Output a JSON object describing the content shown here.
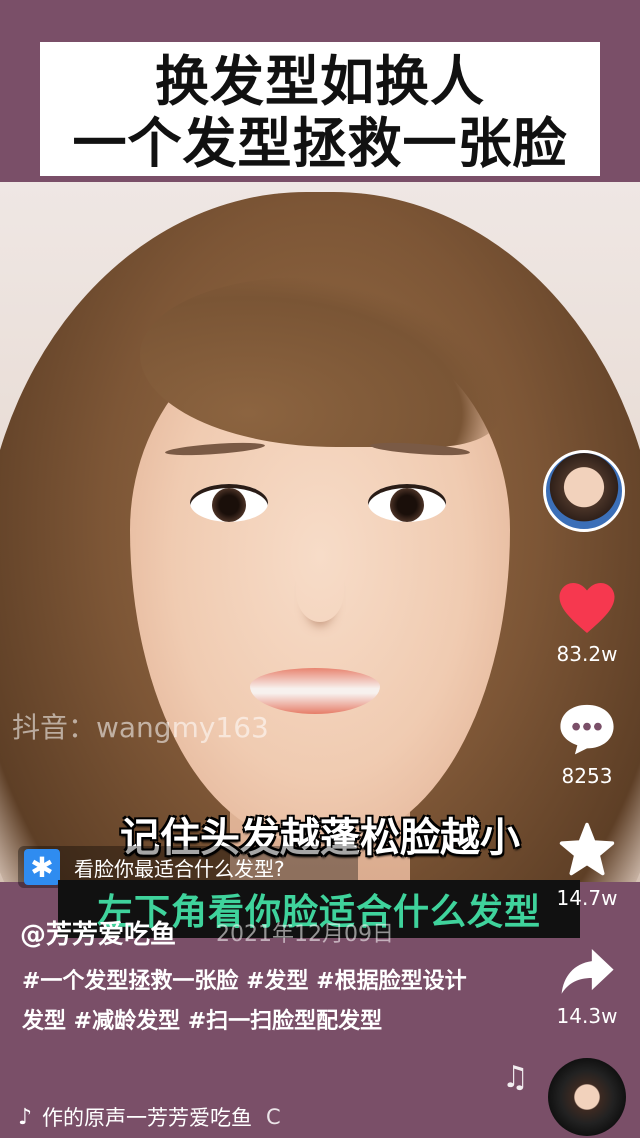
{
  "title": {
    "line1": "换发型如换人",
    "line2": "一个发型拯救一张脸"
  },
  "watermark": "抖音：wangmy163",
  "caption_main": "记住头发越蓬松脸越小",
  "hint": {
    "icon": "asterisk-search-icon",
    "text": "看脸你最适合什么发型?"
  },
  "caption_green": "左下角看你脸适合什么发型",
  "date": "2021年12月09日",
  "author": "@芳芳爱吃鱼",
  "description": "#一个发型拯救一张脸 #发型 #根据脸型设计发型 #减龄发型 #扫一扫脸型配发型",
  "music": {
    "icon": "tiktok-note-icon",
    "text": "作的原声一芳芳爱吃鱼",
    "extra": "C"
  },
  "rail": {
    "likes": "83.2w",
    "comments": "8253",
    "favorites": "14.7w",
    "shares": "14.3w"
  },
  "colors": {
    "like": "#f6384f",
    "caption_green": "#3fd39c",
    "bg": "#7a4f68"
  }
}
